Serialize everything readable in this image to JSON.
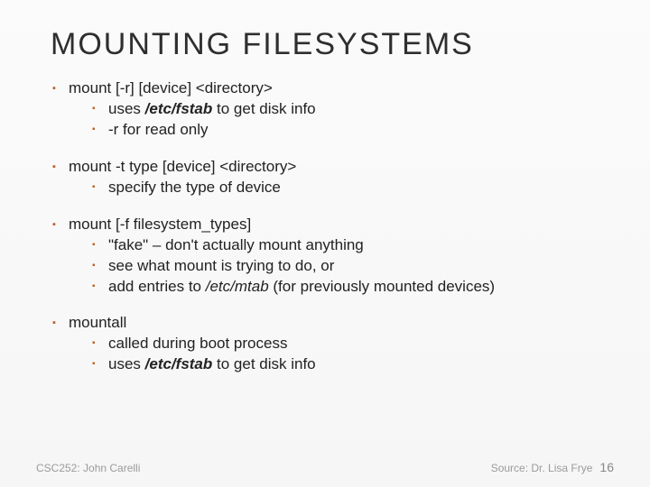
{
  "title": "MOUNTING FILESYSTEMS",
  "g1": {
    "head": "mount  [-r]  [device]     <directory>",
    "s1a": "uses ",
    "s1b": "/etc/fstab",
    "s1c": " to get disk info",
    "s2": "-r for read only"
  },
  "g2": {
    "head": "mount  -t type [device] <directory>",
    "s1": "specify the type of device"
  },
  "g3": {
    "head": "mount  [-f  filesystem_types]",
    "s1": "\"fake\" – don't actually mount anything",
    "s2": "see what mount is trying to do, or",
    "s3a": "add entries to ",
    "s3b": "/etc/mtab",
    "s3c": " (for previously mounted devices)"
  },
  "g4": {
    "head": "mountall",
    "s1": "called during boot process",
    "s2a": "uses ",
    "s2b": "/etc/fstab",
    "s2c": " to get disk info"
  },
  "footer": {
    "left": "CSC252: John Carelli",
    "right": "Source: Dr. Lisa Frye",
    "page": "16"
  }
}
